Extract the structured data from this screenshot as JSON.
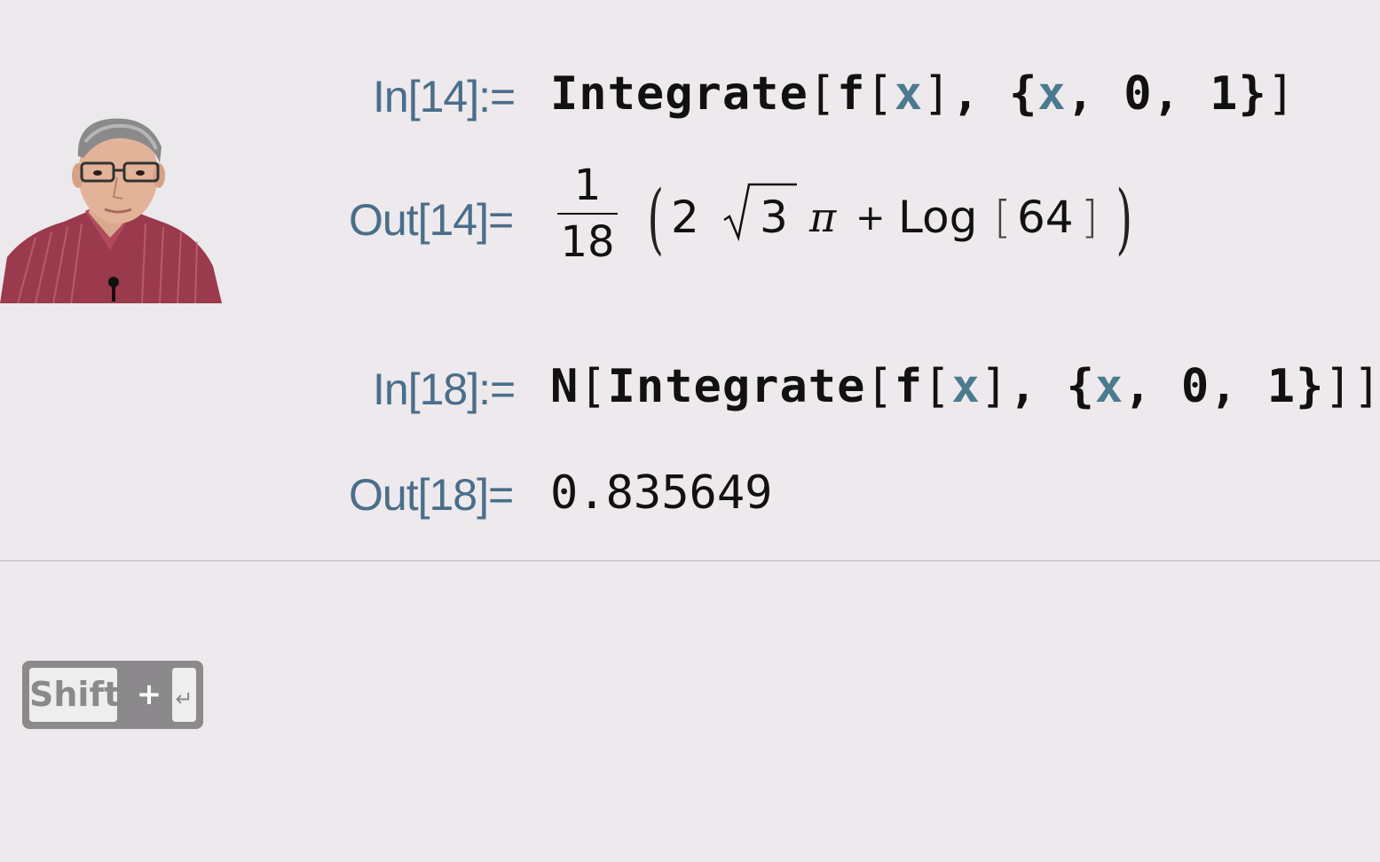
{
  "cells": [
    {
      "in_label": "In[14]:=",
      "input": {
        "head": "Integrate",
        "open": "[",
        "f": "f",
        "f_open": "[",
        "x1": "x",
        "f_close": "]",
        "comma": ",",
        "list_open": "{",
        "x2": "x",
        "comma2": ",",
        "lo": "0",
        "comma3": ",",
        "hi": "1",
        "list_close": "}",
        "close": "]"
      },
      "out_label": "Out[14]=",
      "output": {
        "numerator": "1",
        "denominator": "18",
        "lparen": "(",
        "coef": "2",
        "radicand": "3",
        "pi": "π",
        "plus": "+",
        "log": "Log",
        "log_open": "[",
        "log_arg": "64",
        "log_close": "]",
        "rparen": ")"
      }
    },
    {
      "in_label": "In[18]:=",
      "input": {
        "outer_head": "N",
        "outer_open": "[",
        "head": "Integrate",
        "open": "[",
        "f": "f",
        "f_open": "[",
        "x1": "x",
        "f_close": "]",
        "comma": ",",
        "list_open": "{",
        "x2": "x",
        "comma2": ",",
        "lo": "0",
        "comma3": ",",
        "hi": "1",
        "list_close": "}",
        "close": "]",
        "outer_close": "]"
      },
      "out_label": "Out[18]=",
      "output": "0.835649"
    }
  ],
  "key_hint": {
    "key1": "Shift",
    "plus": "+",
    "key2": "↵"
  },
  "colors": {
    "background": "#ede9ec",
    "label": "#4a6e8a",
    "variable": "#4a7b8e",
    "key_frame": "#8b898b"
  }
}
